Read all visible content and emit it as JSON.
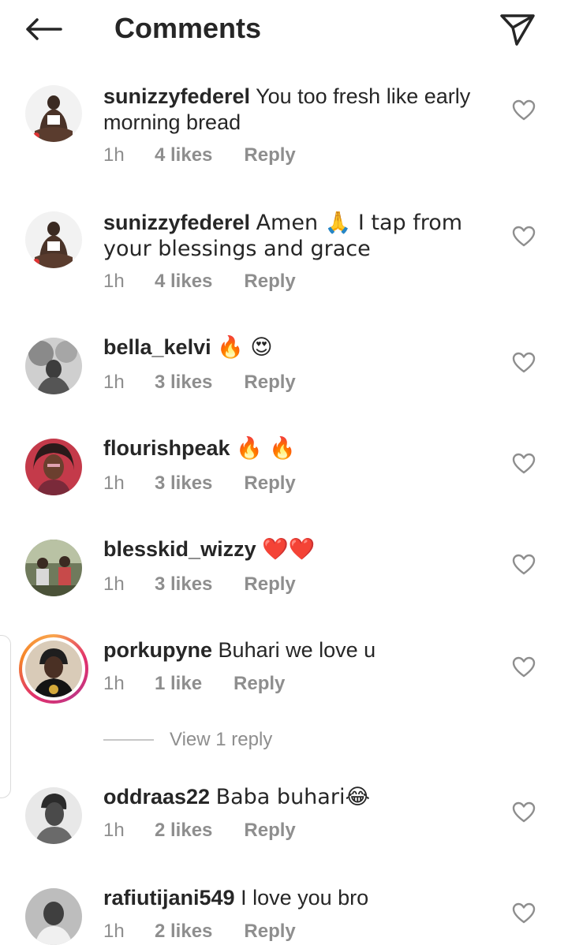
{
  "header": {
    "title": "Comments",
    "back_icon": "arrow-left-icon",
    "send_icon": "paper-plane-icon"
  },
  "comments": [
    {
      "username": "sunizzyfederel",
      "text": "You too fresh like early morning bread",
      "time": "1h",
      "likes": "4 likes",
      "reply": "Reply",
      "avatar": "avatar-sunizzy"
    },
    {
      "username": "sunizzyfederel",
      "text": "Amen 🙏 I tap from your blessings and grace",
      "time": "1h",
      "likes": "4 likes",
      "reply": "Reply",
      "avatar": "avatar-sunizzy"
    },
    {
      "username": "bella_kelvi",
      "text": "🔥 😍",
      "time": "1h",
      "likes": "3 likes",
      "reply": "Reply",
      "avatar": "avatar-bella"
    },
    {
      "username": "flourishpeak",
      "text": "🔥 🔥",
      "time": "1h",
      "likes": "3 likes",
      "reply": "Reply",
      "avatar": "avatar-flourish"
    },
    {
      "username": "blesskid_wizzy",
      "text": "❤️❤️",
      "time": "1h",
      "likes": "3 likes",
      "reply": "Reply",
      "avatar": "avatar-blesskid"
    },
    {
      "username": "porkupyne",
      "text": "Buhari we love u",
      "time": "1h",
      "likes": "1 like",
      "reply": "Reply",
      "avatar": "avatar-porkupyne",
      "has_story": true
    },
    {
      "username": "oddraas22",
      "text": "Baba buhari😂",
      "time": "1h",
      "likes": "2 likes",
      "reply": "Reply",
      "avatar": "avatar-oddraas"
    },
    {
      "username": "rafiutijani549",
      "text": "I love you bro",
      "time": "1h",
      "likes": "2 likes",
      "reply": "Reply",
      "avatar": "avatar-rafiu"
    }
  ],
  "view_replies": {
    "label": "View 1 reply"
  },
  "colors": {
    "text": "#262626",
    "meta": "#8e8e8e",
    "divider": "#c7c7c7",
    "story_ring_start": "#f9a54d",
    "story_ring_end": "#c13584"
  }
}
